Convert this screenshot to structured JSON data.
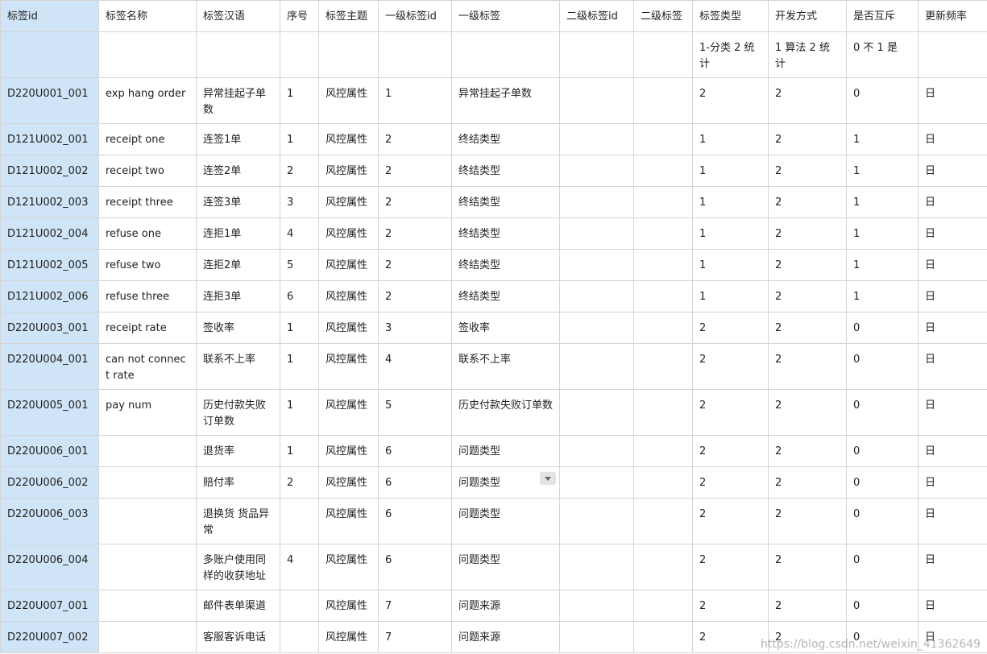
{
  "columns": [
    "标签id",
    "标签名称",
    "标签汉语",
    "序号",
    "标签主题",
    "一级标签id",
    "一级标签",
    "二级标签id",
    "二级标签",
    "标签类型",
    "开发方式",
    "是否互斥",
    "更新频率"
  ],
  "legend": [
    "",
    "",
    "",
    "",
    "",
    "",
    "",
    "",
    "",
    "1-分类 2 统计",
    "1 算法 2 统计",
    "0 不 1 是",
    ""
  ],
  "rows": [
    [
      "D220U001_001",
      "exp hang order",
      "异常挂起子单数",
      "1",
      "风控属性",
      "1",
      "异常挂起子单数",
      "",
      "",
      "2",
      "2",
      "0",
      "日"
    ],
    [
      "D121U002_001",
      "receipt one",
      "连签1单",
      "1",
      "风控属性",
      "2",
      "终结类型",
      "",
      "",
      "1",
      "2",
      "1",
      "日"
    ],
    [
      "D121U002_002",
      "receipt two",
      "连签2单",
      "2",
      "风控属性",
      "2",
      "终结类型",
      "",
      "",
      "1",
      "2",
      "1",
      "日"
    ],
    [
      "D121U002_003",
      "receipt three",
      "连签3单",
      "3",
      "风控属性",
      "2",
      "终结类型",
      "",
      "",
      "1",
      "2",
      "1",
      "日"
    ],
    [
      "D121U002_004",
      "refuse one",
      "连拒1单",
      "4",
      "风控属性",
      "2",
      "终结类型",
      "",
      "",
      "1",
      "2",
      "1",
      "日"
    ],
    [
      "D121U002_005",
      "refuse two",
      "连拒2单",
      "5",
      "风控属性",
      "2",
      "终结类型",
      "",
      "",
      "1",
      "2",
      "1",
      "日"
    ],
    [
      "D121U002_006",
      "refuse three",
      "连拒3单",
      "6",
      "风控属性",
      "2",
      "终结类型",
      "",
      "",
      "1",
      "2",
      "1",
      "日"
    ],
    [
      "D220U003_001",
      "receipt rate",
      "签收率",
      "1",
      "风控属性",
      "3",
      "签收率",
      "",
      "",
      "2",
      "2",
      "0",
      "日"
    ],
    [
      "D220U004_001",
      "can not connect rate",
      "联系不上率",
      "1",
      "风控属性",
      "4",
      "联系不上率",
      "",
      "",
      "2",
      "2",
      "0",
      "日"
    ],
    [
      "D220U005_001",
      "pay num",
      "历史付款失败订单数",
      "1",
      "风控属性",
      "5",
      "历史付款失败订单数",
      "",
      "",
      "2",
      "2",
      "0",
      "日"
    ],
    [
      "D220U006_001",
      "",
      "退货率",
      "1",
      "风控属性",
      "6",
      "问题类型",
      "",
      "",
      "2",
      "2",
      "0",
      "日"
    ],
    [
      "D220U006_002",
      "",
      "赔付率",
      "2",
      "风控属性",
      "6",
      "问题类型",
      "",
      "",
      "2",
      "2",
      "0",
      "日"
    ],
    [
      "D220U006_003",
      "",
      "退换货 货品异常",
      "",
      "风控属性",
      "6",
      "问题类型",
      "",
      "",
      "2",
      "2",
      "0",
      "日"
    ],
    [
      "D220U006_004",
      "",
      "多账户使用同样的收获地址",
      "4",
      "风控属性",
      "6",
      "问题类型",
      "",
      "",
      "2",
      "2",
      "0",
      "日"
    ],
    [
      "D220U007_001",
      "",
      "邮件表单渠道",
      "",
      "风控属性",
      "7",
      "问题来源",
      "",
      "",
      "2",
      "2",
      "0",
      "日"
    ],
    [
      "D220U007_002",
      "",
      "客服客诉电话",
      "",
      "风控属性",
      "7",
      "问题来源",
      "",
      "",
      "2",
      "2",
      "0",
      "日"
    ]
  ],
  "watermark": "https://blog.csdn.net/weixin_41362649"
}
